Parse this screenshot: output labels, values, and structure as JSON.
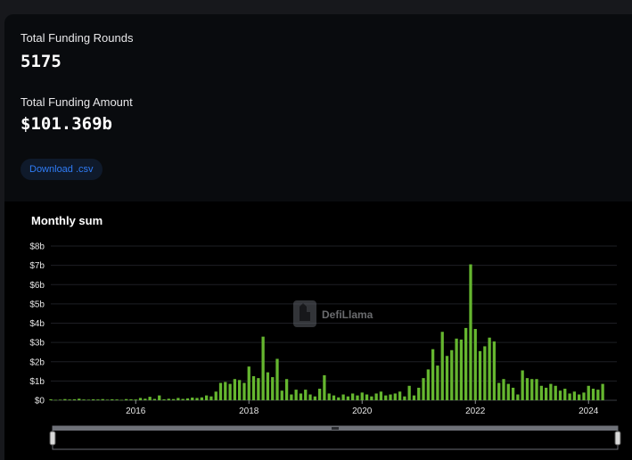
{
  "stats": {
    "rounds_label": "Total Funding Rounds",
    "rounds_value": "5175",
    "amount_label": "Total Funding Amount",
    "amount_value": "$101.369b"
  },
  "download_label": "Download .csv",
  "watermark": "DefiLlama",
  "colors": {
    "bar": "#65b62f",
    "grid": "#1e1f24",
    "button_text": "#2f7cf6"
  },
  "chart_data": {
    "type": "bar",
    "title": "Monthly sum",
    "ylim": [
      0,
      8
    ],
    "y_ticks": [
      "$0",
      "$1b",
      "$2b",
      "$3b",
      "$4b",
      "$5b",
      "$6b",
      "$7b",
      "$8b"
    ],
    "x_ticks": [
      {
        "label": "2016",
        "x": 2016.0
      },
      {
        "label": "2018",
        "x": 2018.0
      },
      {
        "label": "2020",
        "x": 2020.0
      },
      {
        "label": "2022",
        "x": 2022.0
      },
      {
        "label": "2024",
        "x": 2024.0
      }
    ],
    "start": 2014.5,
    "end": 2024.5,
    "x": [
      2014.5,
      2014.583,
      2014.667,
      2014.75,
      2014.833,
      2014.917,
      2015.0,
      2015.083,
      2015.167,
      2015.25,
      2015.333,
      2015.417,
      2015.5,
      2015.583,
      2015.667,
      2015.75,
      2015.833,
      2015.917,
      2016.0,
      2016.083,
      2016.167,
      2016.25,
      2016.333,
      2016.417,
      2016.5,
      2016.583,
      2016.667,
      2016.75,
      2016.833,
      2016.917,
      2017.0,
      2017.083,
      2017.167,
      2017.25,
      2017.333,
      2017.417,
      2017.5,
      2017.583,
      2017.667,
      2017.75,
      2017.833,
      2017.917,
      2018.0,
      2018.083,
      2018.167,
      2018.25,
      2018.333,
      2018.417,
      2018.5,
      2018.583,
      2018.667,
      2018.75,
      2018.833,
      2018.917,
      2019.0,
      2019.083,
      2019.167,
      2019.25,
      2019.333,
      2019.417,
      2019.5,
      2019.583,
      2019.667,
      2019.75,
      2019.833,
      2019.917,
      2020.0,
      2020.083,
      2020.167,
      2020.25,
      2020.333,
      2020.417,
      2020.5,
      2020.583,
      2020.667,
      2020.75,
      2020.833,
      2020.917,
      2021.0,
      2021.083,
      2021.167,
      2021.25,
      2021.333,
      2021.417,
      2021.5,
      2021.583,
      2021.667,
      2021.75,
      2021.833,
      2021.917,
      2022.0,
      2022.083,
      2022.167,
      2022.25,
      2022.333,
      2022.417,
      2022.5,
      2022.583,
      2022.667,
      2022.75,
      2022.833,
      2022.917,
      2023.0,
      2023.083,
      2023.167,
      2023.25,
      2023.333,
      2023.417,
      2023.5,
      2023.583,
      2023.667,
      2023.75,
      2023.833,
      2023.917,
      2024.0,
      2024.083,
      2024.167,
      2024.25
    ],
    "values": [
      0.05,
      0.02,
      0.03,
      0.06,
      0.04,
      0.05,
      0.08,
      0.04,
      0.03,
      0.05,
      0.04,
      0.06,
      0.03,
      0.05,
      0.04,
      0.02,
      0.06,
      0.05,
      0.04,
      0.12,
      0.08,
      0.18,
      0.07,
      0.25,
      0.05,
      0.08,
      0.06,
      0.12,
      0.07,
      0.1,
      0.14,
      0.12,
      0.15,
      0.25,
      0.2,
      0.45,
      0.9,
      0.95,
      0.85,
      1.1,
      1.05,
      0.9,
      1.75,
      1.25,
      1.15,
      3.3,
      1.45,
      1.2,
      2.15,
      0.5,
      1.1,
      0.3,
      0.55,
      0.35,
      0.55,
      0.3,
      0.2,
      0.6,
      1.3,
      0.35,
      0.25,
      0.15,
      0.3,
      0.2,
      0.35,
      0.25,
      0.4,
      0.3,
      0.2,
      0.35,
      0.45,
      0.25,
      0.3,
      0.35,
      0.45,
      0.2,
      0.75,
      0.25,
      0.65,
      1.15,
      1.6,
      2.65,
      1.8,
      3.55,
      2.3,
      2.6,
      3.2,
      3.15,
      3.75,
      7.05,
      3.7,
      2.55,
      2.8,
      3.25,
      3.05,
      0.9,
      1.1,
      0.85,
      0.65,
      0.3,
      1.55,
      1.15,
      1.1,
      1.1,
      0.75,
      0.65,
      0.85,
      0.75,
      0.5,
      0.6,
      0.35,
      0.45,
      0.3,
      0.4,
      0.75,
      0.6,
      0.55,
      0.85
    ]
  }
}
